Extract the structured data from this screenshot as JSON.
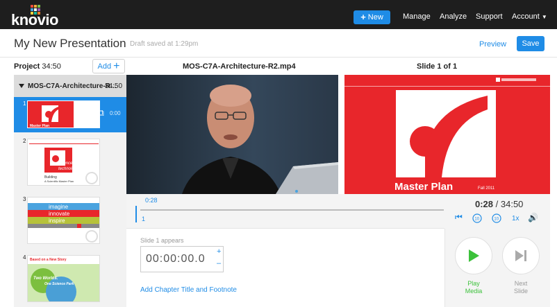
{
  "nav": {
    "logo_text": "knovio",
    "new_label": "New",
    "manage": "Manage",
    "analyze": "Analyze",
    "support": "Support",
    "account": "Account",
    "colors": {
      "bg": "#1e1e1e",
      "accent": "#1f8ce6"
    }
  },
  "title": {
    "presentation": "My New Presentation",
    "draft_status": "Draft saved at 1:29pm",
    "preview": "Preview",
    "save": "Save"
  },
  "header": {
    "project_label": "Project",
    "project_duration": "34:50",
    "add_label": "Add",
    "media_name": "MOS-C7A-Architecture-R2.mp4",
    "slide_count": "Slide 1 of 1"
  },
  "sidebar": {
    "chapter_name": "MOS-C7A-Architecture-R...",
    "chapter_duration": "34:50",
    "slides": [
      {
        "num": "1",
        "time": "0:00",
        "thumb_caption": "Master Plan"
      },
      {
        "num": "2",
        "thumb_lines": [
          "science",
          "technology",
          "Building",
          "A Scientific Master Plan"
        ]
      },
      {
        "num": "3",
        "thumb_lines": [
          "imagine",
          "innovate",
          "inspire"
        ]
      },
      {
        "num": "4",
        "thumb_title": "Based on a New Story",
        "thumb_lines": [
          "Two Worlds.",
          "One Science Park"
        ]
      }
    ]
  },
  "slide_preview": {
    "caption": "Master Plan",
    "date": "Fall 2011"
  },
  "timeline": {
    "marker_time": "0:28",
    "marker_slide": "1",
    "progress": 0.0134
  },
  "controls": {
    "current": "0:28",
    "total": "/ 34:50",
    "speed": "1x"
  },
  "editor": {
    "appears_label": "Slide 1 appears",
    "timecode_value": "00:00:00.0",
    "plus": "+",
    "minus": "–",
    "chapter_link": "Add Chapter Title and Footnote"
  },
  "play": {
    "play_label_1": "Play",
    "play_label_2": "Media",
    "next_label_1": "Next",
    "next_label_2": "Slide"
  }
}
